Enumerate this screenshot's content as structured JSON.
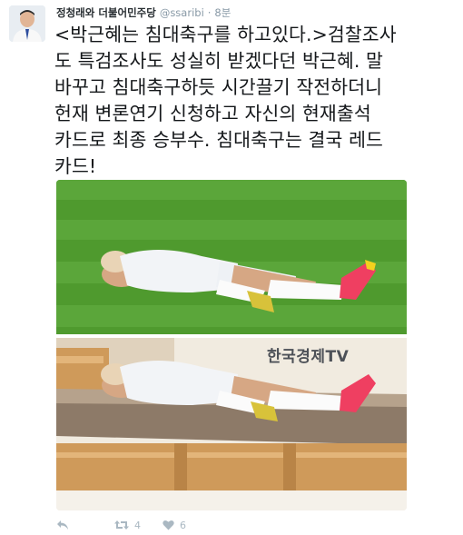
{
  "author": {
    "name": "정청래와 더불어민주당",
    "handle": "@ssaribi",
    "separator": "·",
    "time": "8분"
  },
  "tweet": {
    "text": "<박근혜는 침대축구를 하고있다.>검찰조사\n도 특검조사도 성실히 받겠다던 박근혜. 말\n바꾸고 침대축구하듯 시간끌기 작전하더니\n헌재 변론연기 신청하고 자신의 현재출석\n카드로 최종 승부수. 침대축구는 결국 레드\n카드!"
  },
  "media": {
    "watermark": "한국경제TV",
    "colors": {
      "grass": "#4f9a2e",
      "grass_light": "#5ba63a",
      "wall": "#f1ebe0",
      "bed_wood": "#cf9a5a",
      "blanket": "#8d7a68"
    }
  },
  "actions": {
    "reply_icon": "reply-icon",
    "retweet_icon": "retweet-icon",
    "retweet_count": "4",
    "like_icon": "heart-icon",
    "like_count": "6",
    "muted_color": "#aab8c2"
  }
}
